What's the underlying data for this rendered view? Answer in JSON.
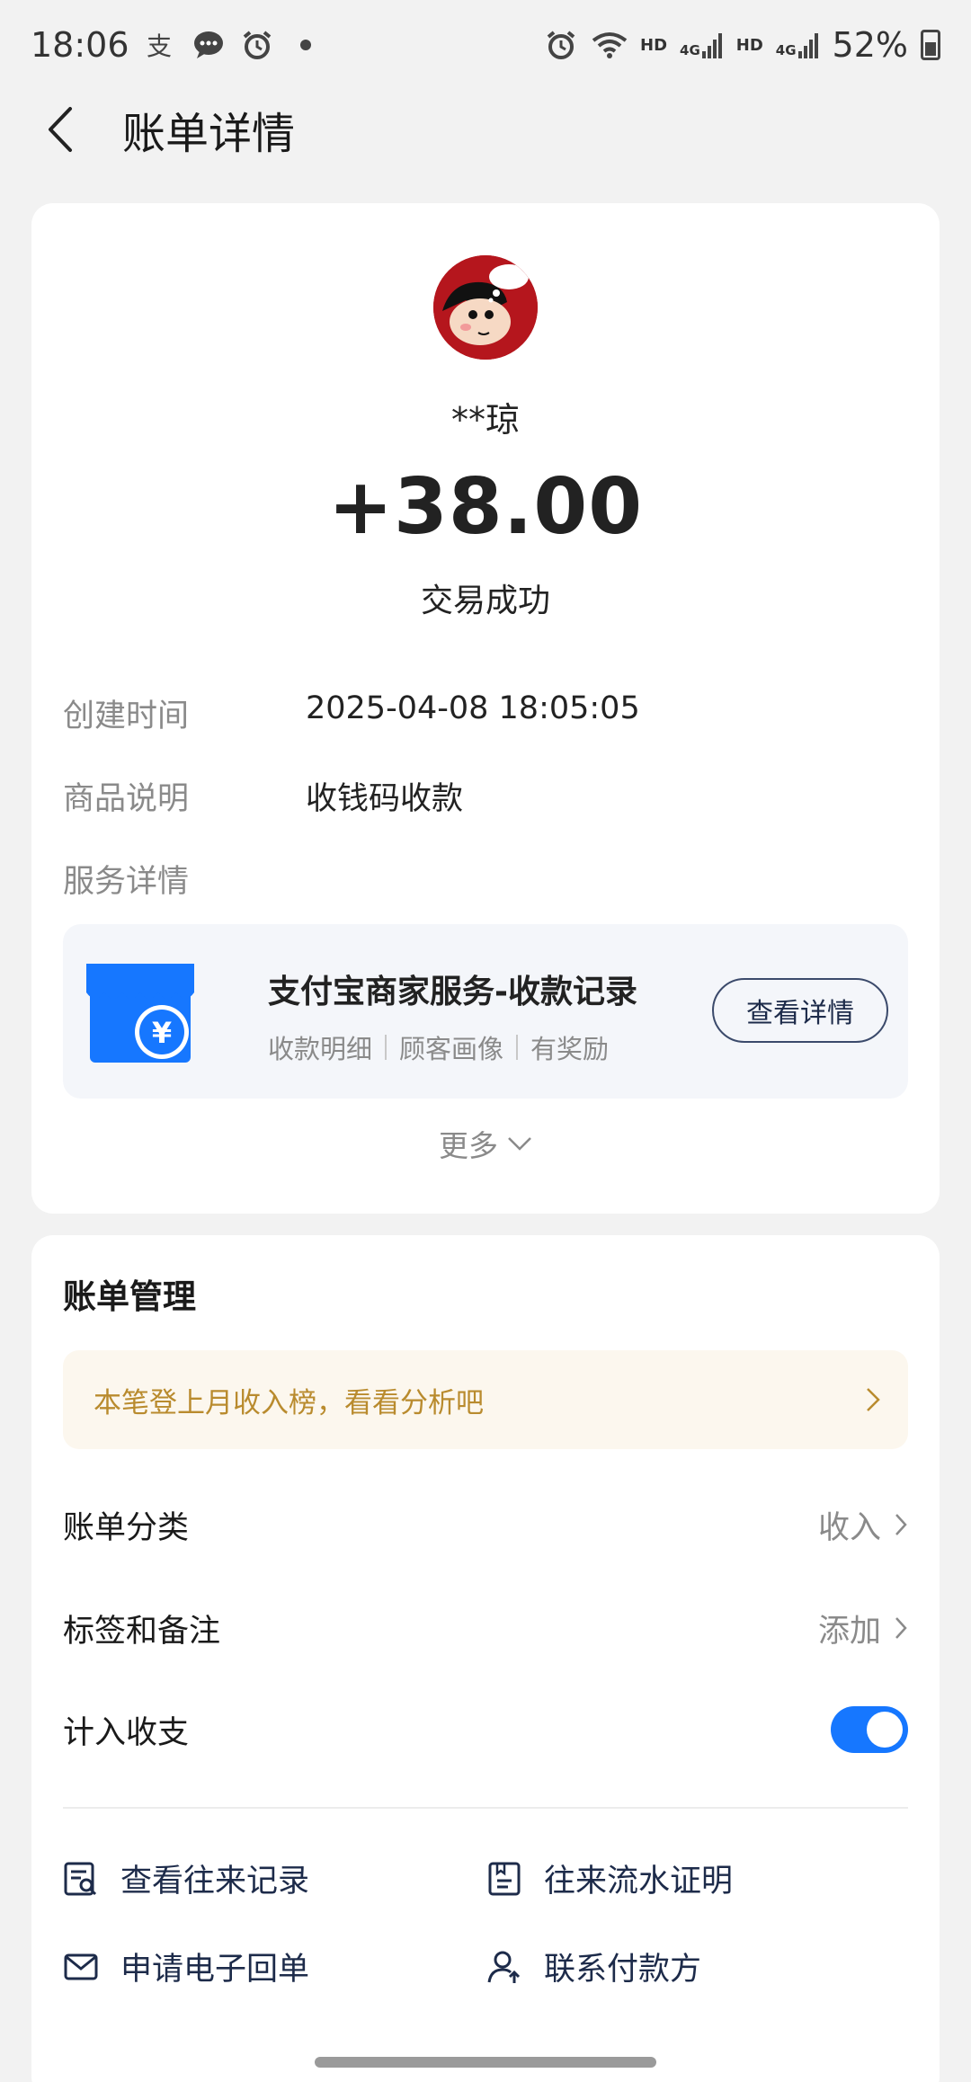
{
  "status_bar": {
    "time": "18:06",
    "battery": "52%",
    "net_hd1": "HD",
    "net_4g1": "4G",
    "net_hd2": "HD",
    "net_4g2": "4G"
  },
  "header": {
    "title": "账单详情"
  },
  "transaction": {
    "name": "**琼",
    "amount": "+38.00",
    "status": "交易成功",
    "rows": [
      {
        "label": "创建时间",
        "value": "2025-04-08 18:05:05"
      },
      {
        "label": "商品说明",
        "value": "收钱码收款"
      },
      {
        "label": "服务详情",
        "value": ""
      }
    ]
  },
  "service": {
    "title": "支付宝商家服务-收款记录",
    "tags": [
      "收款明细",
      "顾客画像",
      "有奖励"
    ],
    "button": "查看详情"
  },
  "more_label": "更多",
  "bill_management": {
    "title": "账单管理",
    "promo": "本笔登上月收入榜，看看分析吧",
    "category_label": "账单分类",
    "category_value": "收入",
    "tags_label": "标签和备注",
    "tags_value": "添加",
    "include_label": "计入收支",
    "include_on": true,
    "actions": [
      {
        "label": "查看往来记录",
        "icon": "records-icon"
      },
      {
        "label": "往来流水证明",
        "icon": "statement-icon"
      },
      {
        "label": "申请电子回单",
        "icon": "mail-icon"
      },
      {
        "label": "联系付款方",
        "icon": "contact-icon"
      }
    ]
  },
  "colors": {
    "accent": "#1677ff",
    "promo_text": "#b98b2e",
    "avatar_bg": "#b5161d"
  }
}
